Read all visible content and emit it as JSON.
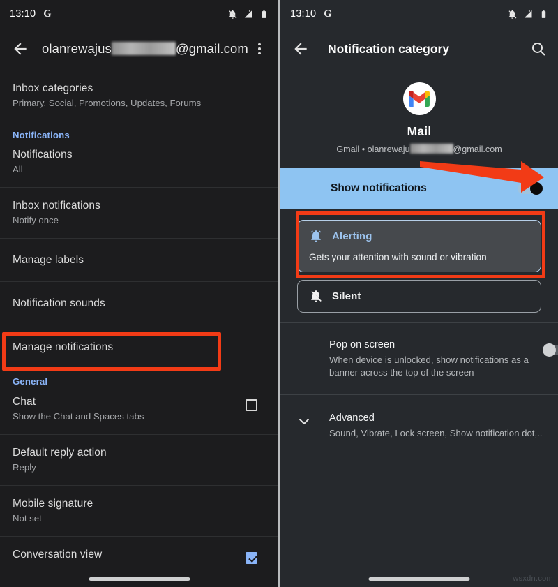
{
  "status_bar": {
    "time": "13:10",
    "google_badge": "G",
    "icons": [
      "notifications-off-icon",
      "signal-no-service-icon",
      "battery-icon"
    ]
  },
  "left_screen": {
    "appbar": {
      "back_icon": "back-arrow-icon",
      "title_prefix": "olanrewajus",
      "title_suffix": "@gmail.com",
      "overflow_icon": "more-vert-icon"
    },
    "items": [
      {
        "title": "Inbox categories",
        "subtitle": "Primary, Social, Promotions, Updates, Forums"
      },
      {
        "section": "Notifications"
      },
      {
        "title": "Notifications",
        "subtitle": "All"
      },
      {
        "title": "Inbox notifications",
        "subtitle": "Notify once"
      },
      {
        "title": "Manage labels",
        "subtitle": ""
      },
      {
        "title": "Notification sounds",
        "subtitle": ""
      },
      {
        "title": "Manage notifications",
        "subtitle": "",
        "highlighted": true
      },
      {
        "section": "General"
      },
      {
        "title": "Chat",
        "subtitle": "Show the Chat and Spaces tabs",
        "checkbox": "unchecked"
      },
      {
        "title": "Default reply action",
        "subtitle": "Reply"
      },
      {
        "title": "Mobile signature",
        "subtitle": "Not set"
      },
      {
        "title": "Conversation view",
        "subtitle": "",
        "checkbox": "checked"
      }
    ]
  },
  "right_screen": {
    "appbar": {
      "back_icon": "back-arrow-icon",
      "title": "Notification category",
      "search_icon": "search-icon"
    },
    "hero": {
      "logo_icon": "gmail-logo-icon",
      "app_name": "Mail",
      "subtitle_prefix": "Gmail • olanrewaju",
      "subtitle_suffix": "@gmail.com"
    },
    "show_notifications": {
      "label": "Show notifications",
      "toggle_state": "on",
      "toggle_name": "show-notifications-toggle"
    },
    "choices": [
      {
        "id": "alerting",
        "icon": "bell-icon",
        "title": "Alerting",
        "description": "Gets your attention with sound or vibration",
        "selected": true
      },
      {
        "id": "silent",
        "icon": "bell-off-icon",
        "title": "Silent",
        "description": "",
        "selected": false
      }
    ],
    "settings": [
      {
        "id": "pop-on-screen",
        "title": "Pop on screen",
        "description": "When device is unlocked, show notifications as a banner across the top of the screen",
        "toggle_state": "off"
      },
      {
        "id": "advanced",
        "icon": "chevron-down-icon",
        "title": "Advanced",
        "description": "Sound, Vibrate, Lock screen, Show notification dot,.."
      }
    ]
  },
  "annotations": {
    "arrow_color": "#f23b16",
    "box_color": "#f23b16",
    "arrow_name": "red-pointer-arrow"
  },
  "watermark": "wsxdn.com",
  "colors": {
    "accent_blue": "#8ab4f8",
    "highlight_band": "#8ec4f2",
    "left_bg": "#1c1c1e",
    "right_bg": "#26292d"
  }
}
